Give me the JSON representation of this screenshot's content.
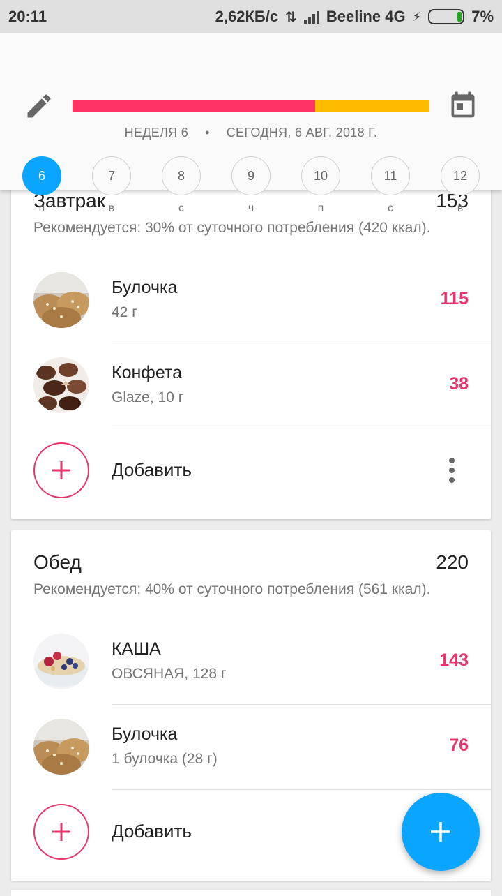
{
  "status_bar": {
    "time": "20:11",
    "speed": "2,62КБ/с",
    "carrier": "Beeline 4G",
    "battery": "7%"
  },
  "header": {
    "progress": {
      "red_fraction": 0.68,
      "colors": {
        "red": "#ff3366",
        "yellow": "#ffbb00"
      }
    },
    "week": "НЕДЕЛЯ 6",
    "separator": "•",
    "today": "СЕГОДНЯ, 6 АВГ. 2018 Г.",
    "days": [
      {
        "num": "6",
        "wd": "п",
        "active": true
      },
      {
        "num": "7",
        "wd": "в"
      },
      {
        "num": "8",
        "wd": "с"
      },
      {
        "num": "9",
        "wd": "ч"
      },
      {
        "num": "10",
        "wd": "п"
      },
      {
        "num": "11",
        "wd": "с"
      },
      {
        "num": "12",
        "wd": "в"
      }
    ]
  },
  "meals": [
    {
      "title": "Завтрак",
      "total": "153",
      "recommendation": "Рекомендуется: 30% от суточного потребления (420 ккал).",
      "items": [
        {
          "name": "Булочка",
          "sub": "42 г",
          "kcal": "115",
          "icon": "bun-photo"
        },
        {
          "name": "Конфета",
          "sub": "Glaze, 10 г",
          "kcal": "38",
          "icon": "candy-photo"
        }
      ],
      "add_label": "Добавить"
    },
    {
      "title": "Обед",
      "total": "220",
      "recommendation": "Рекомендуется: 40% от суточного потребления (561 ккал).",
      "items": [
        {
          "name": "КАША",
          "sub": "ОВСЯНАЯ, 128 г",
          "kcal": "143",
          "icon": "porridge-photo"
        },
        {
          "name": "Булочка",
          "sub": "1 булочка (28 г)",
          "kcal": "76",
          "icon": "bun-photo"
        }
      ],
      "add_label": "Добавить"
    }
  ],
  "accent_color": "#0aa5ff",
  "kcal_color": "#e8336b"
}
